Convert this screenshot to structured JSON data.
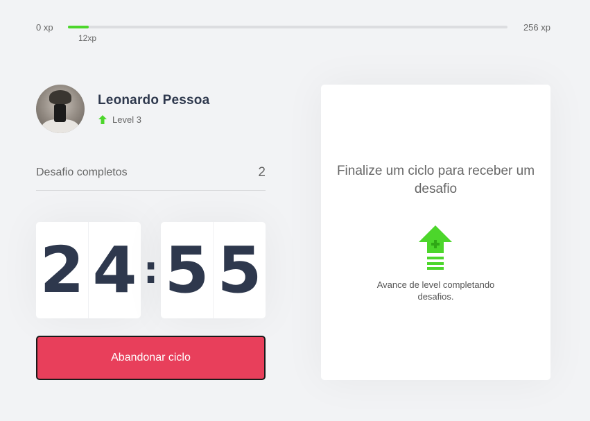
{
  "xp": {
    "min_label": "0 xp",
    "max_label": "256 xp",
    "current_label": "12xp",
    "current_value": 12,
    "max_value": 256,
    "fill_color": "#4cd62b"
  },
  "profile": {
    "name": "Leonardo Pessoa",
    "level_label": "Level 3",
    "level_icon": "level-up-arrow-icon"
  },
  "completed": {
    "label": "Desafio completos",
    "count": "2"
  },
  "countdown": {
    "minutes": [
      "2",
      "4"
    ],
    "separator": ":",
    "seconds": [
      "5",
      "5"
    ]
  },
  "abandon_button": {
    "label": "Abandonar ciclo",
    "color": "#e83f5b"
  },
  "challenge_box": {
    "title": "Finalize um ciclo para receber um desafio",
    "icon": "level-up-icon",
    "description": "Avance de level completando desafios."
  }
}
